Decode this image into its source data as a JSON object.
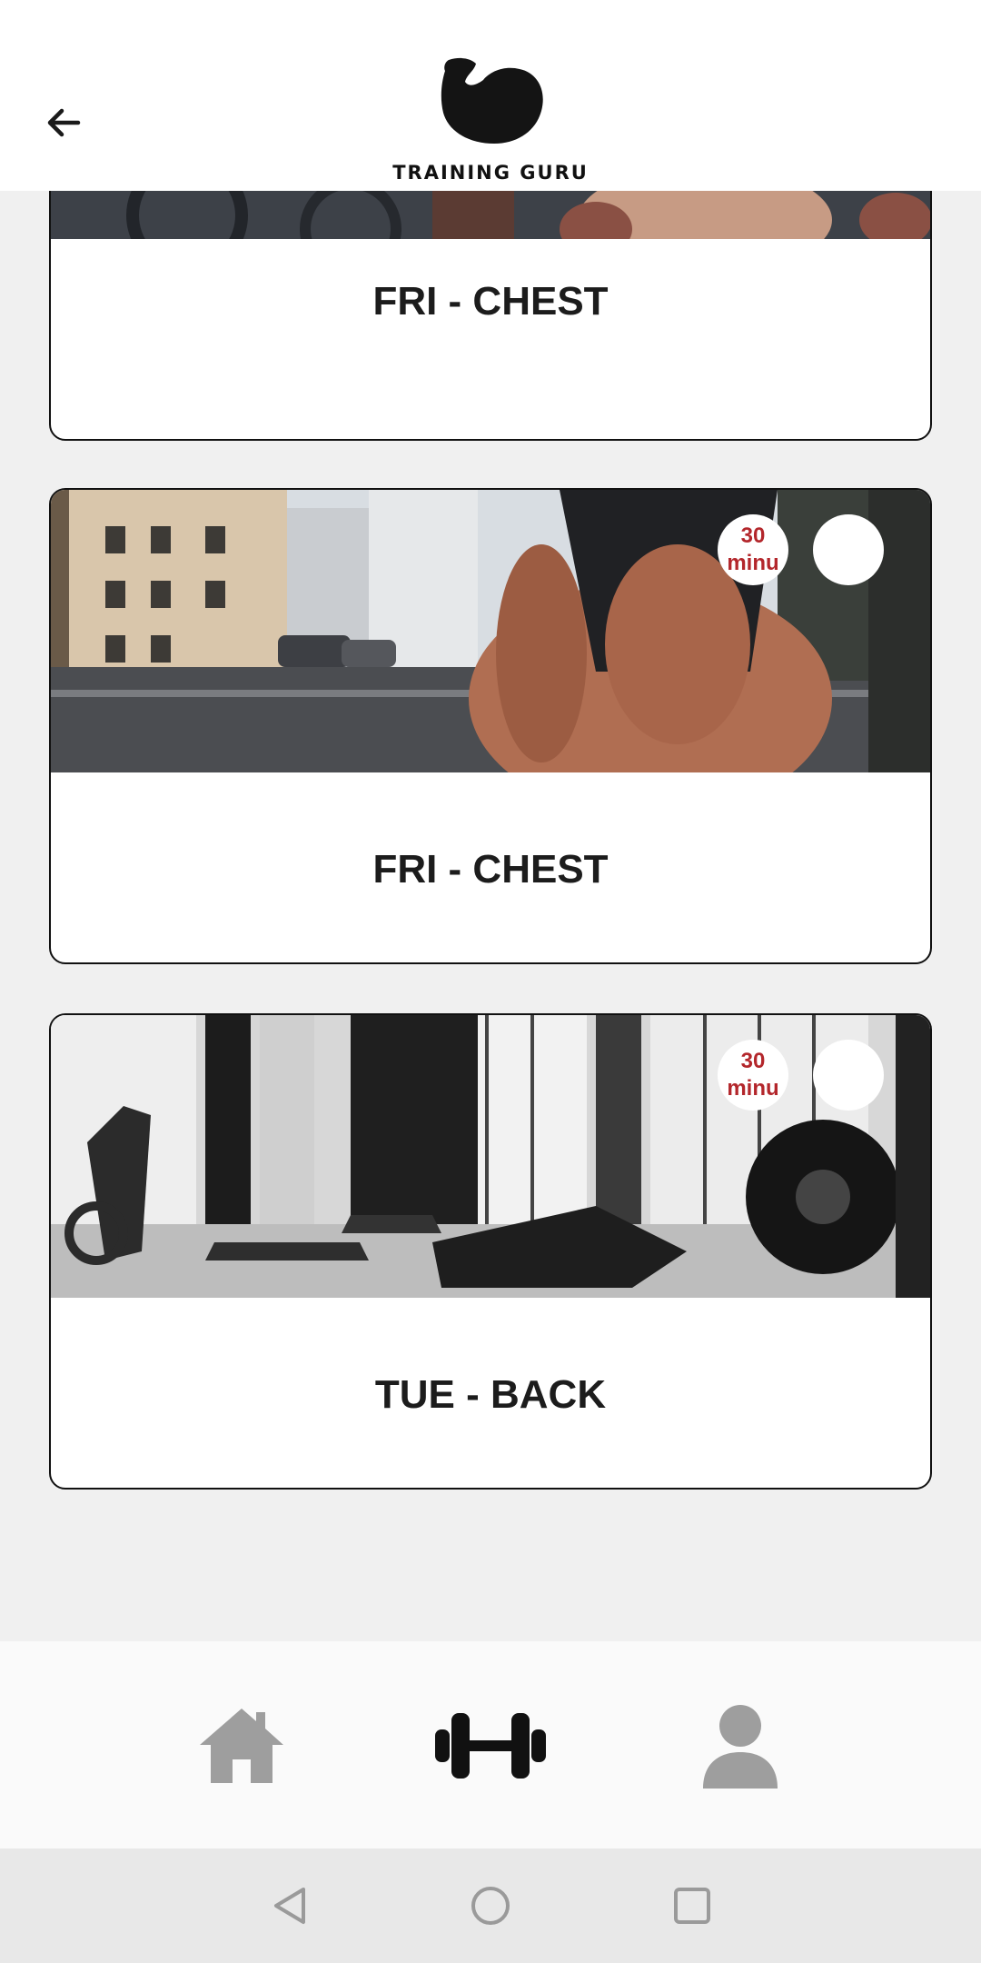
{
  "header": {
    "back_icon": "arrow-left-icon",
    "logo_text": "TRAINING GURU"
  },
  "workouts": [
    {
      "title": "FRI - CHEST",
      "duration": "",
      "image": "gym-equipment-partial"
    },
    {
      "title": "FRI - CHEST",
      "duration": "30 minu",
      "image": "man-tying-shoe-street"
    },
    {
      "title": "TUE - BACK",
      "duration": "30 minu",
      "image": "gym-interior-bw"
    }
  ],
  "bottom_nav": {
    "items": [
      {
        "icon": "home-icon",
        "active": false
      },
      {
        "icon": "dumbbell-icon",
        "active": true
      },
      {
        "icon": "profile-icon",
        "active": false
      }
    ]
  },
  "colors": {
    "badge_text": "#b3262b",
    "inactive_icon": "#9e9e9e",
    "active_icon": "#111111",
    "background": "#f0f0f0"
  }
}
